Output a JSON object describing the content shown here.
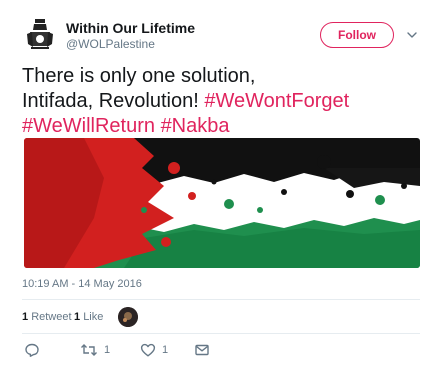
{
  "user": {
    "display_name": "Within Our Lifetime",
    "handle": "@WOLPalestine",
    "avatar_icon": "emblem-avatar-icon"
  },
  "follow_button": {
    "label": "Follow",
    "color": "#e0245e"
  },
  "menu_icon": "chevron-down-icon",
  "tweet": {
    "text_line1": "There is only one solution,",
    "text_line2_plain": "Intifada, Revolution!",
    "hashtag1": "#WeWontForget",
    "hashtag2": "#WeWillReturn",
    "hashtag3": "#Nakba",
    "hashtag_color": "#e0245e"
  },
  "media": {
    "description_icon": "palestinian-flag-paint-splatter-image",
    "colors": [
      "#d2201f",
      "#111111",
      "#ffffff",
      "#1f8f4e"
    ]
  },
  "timestamp": "10:19 AM - 14 May 2016",
  "stats": {
    "retweets_count": "1",
    "retweets_label": "Retweet",
    "likes_count": "1",
    "likes_label": "Like"
  },
  "actions": {
    "reply_icon": "reply-icon",
    "retweet_icon": "retweet-icon",
    "retweet_count": "1",
    "like_icon": "heart-icon",
    "like_count": "1",
    "dm_icon": "direct-message-icon"
  }
}
